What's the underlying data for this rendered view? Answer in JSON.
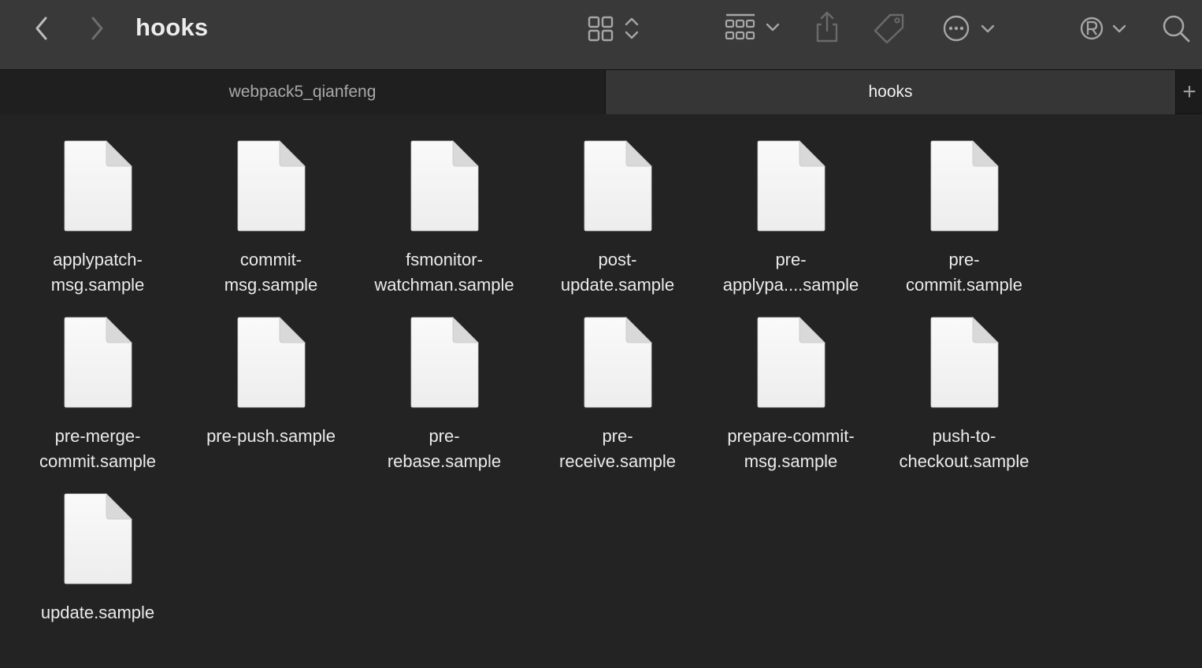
{
  "window": {
    "title": "hooks"
  },
  "toolbar": {
    "back_icon": "chevron-left-icon",
    "forward_icon": "chevron-right-icon",
    "view_icon": "icon-grid-view-icon",
    "group_icon": "group-by-icon",
    "share_icon": "share-icon",
    "tag_icon": "tag-icon",
    "action_icon": "more-actions-icon",
    "extension_icon": "registered-extension-icon",
    "search_icon": "search-icon"
  },
  "tabs": [
    {
      "label": "webpack5_qianfeng",
      "active": false
    },
    {
      "label": "hooks",
      "active": true
    }
  ],
  "add_tab_label": "+",
  "files": [
    {
      "name": "applypatch-\nmsg.sample",
      "icon": "document-icon"
    },
    {
      "name": "commit-\nmsg.sample",
      "icon": "document-icon"
    },
    {
      "name": "fsmonitor-\nwatchman.sample",
      "icon": "document-icon"
    },
    {
      "name": "post-\nupdate.sample",
      "icon": "document-icon"
    },
    {
      "name": "pre-\napplypa....sample",
      "icon": "document-icon"
    },
    {
      "name": "pre-\ncommit.sample",
      "icon": "document-icon"
    },
    {
      "name": "pre-merge-\ncommit.sample",
      "icon": "document-icon"
    },
    {
      "name": "pre-push.sample",
      "icon": "document-icon"
    },
    {
      "name": "pre-\nrebase.sample",
      "icon": "document-icon"
    },
    {
      "name": "pre-\nreceive.sample",
      "icon": "document-icon"
    },
    {
      "name": "prepare-commit-\nmsg.sample",
      "icon": "document-icon"
    },
    {
      "name": "push-to-\ncheckout.sample",
      "icon": "document-icon"
    },
    {
      "name": "update.sample",
      "icon": "document-icon"
    }
  ],
  "colors": {
    "toolbar_bg": "#393939",
    "content_bg": "#232323",
    "active_tab_bg": "#363636",
    "icon_gray": "#9a9a9a"
  }
}
